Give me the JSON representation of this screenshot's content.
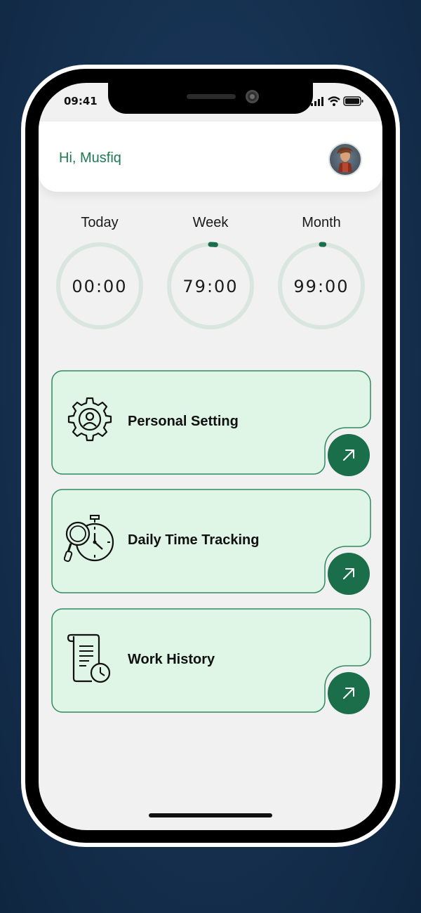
{
  "status_bar": {
    "time": "09:41",
    "signal_icon": "signal-icon",
    "wifi_icon": "wifi-icon",
    "battery_icon": "battery-icon"
  },
  "header": {
    "greeting": "Hi, Musfiq",
    "avatar_icon": "avatar"
  },
  "timers": [
    {
      "label": "Today",
      "value": "00:00",
      "progress": 0
    },
    {
      "label": "Week",
      "value": "79:00",
      "progress": 0.02
    },
    {
      "label": "Month",
      "value": "99:00",
      "progress": 0.01
    }
  ],
  "menu": [
    {
      "label": "Personal Setting",
      "icon": "gear-user-icon"
    },
    {
      "label": "Daily Time Tracking",
      "icon": "stopwatch-search-icon"
    },
    {
      "label": "Work History",
      "icon": "document-clock-icon"
    }
  ],
  "colors": {
    "accent": "#1a6e49",
    "card_bg": "#dff5e5",
    "ring_track": "#d9e6e0",
    "greeting": "#1f7a52"
  }
}
